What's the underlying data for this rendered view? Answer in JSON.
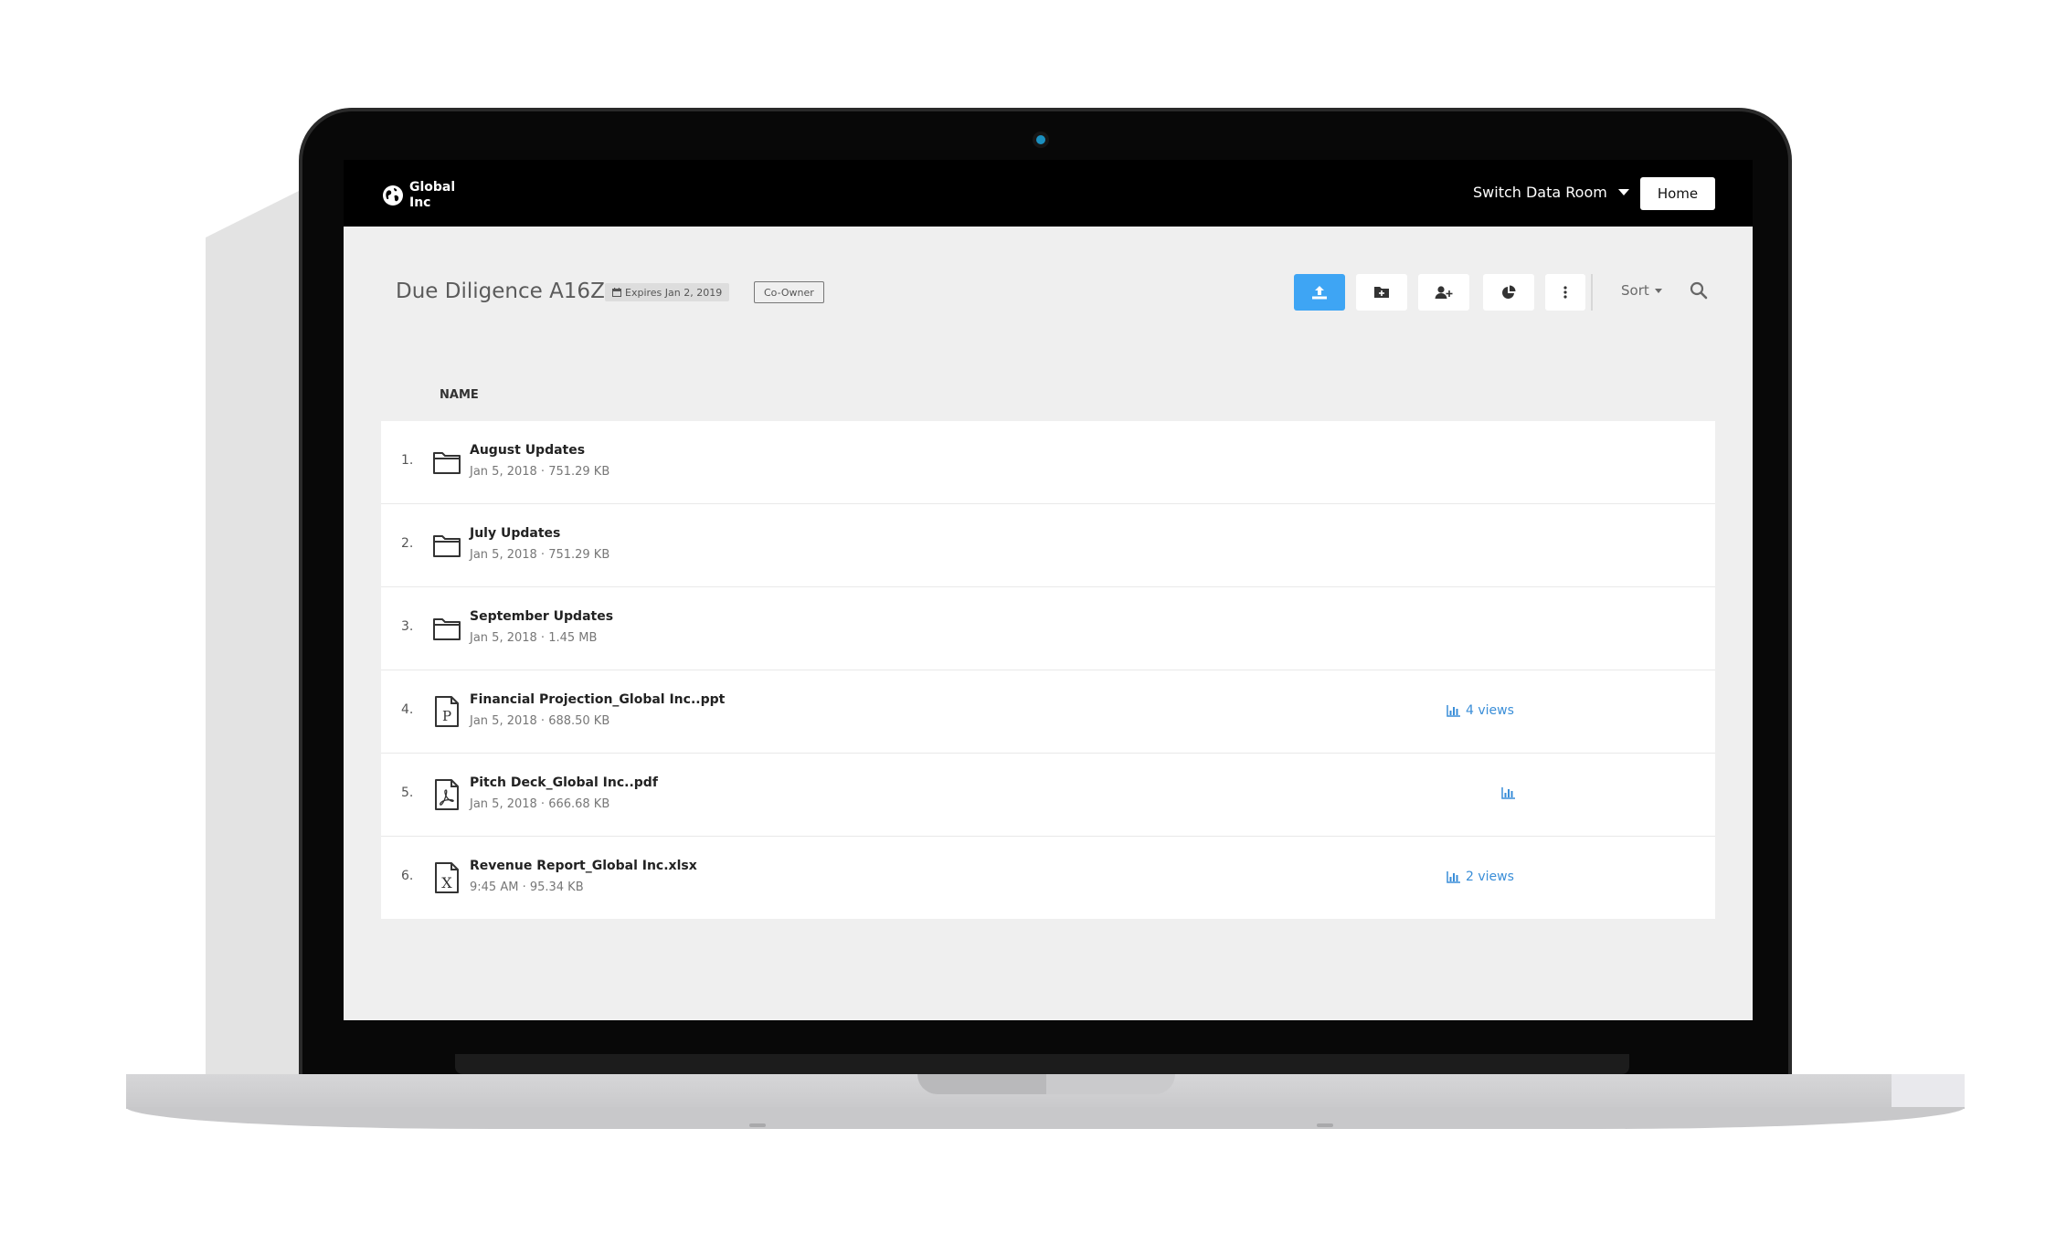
{
  "app": {
    "logo_icon": "globe-icon",
    "logo_text": "Global Inc",
    "switch_room_label": "Switch Data Room",
    "home_label": "Home"
  },
  "room": {
    "title": "Due Diligence A16Z",
    "expires_label": "Expires Jan 2, 2019",
    "role_label": "Co-Owner"
  },
  "toolbar": {
    "buttons": [
      {
        "icon": "upload-icon",
        "primary": true
      },
      {
        "icon": "new-folder-icon",
        "primary": false
      },
      {
        "icon": "add-user-icon",
        "primary": false
      },
      {
        "icon": "pie-chart-icon",
        "primary": false
      },
      {
        "icon": "more-vertical-icon",
        "primary": false
      }
    ],
    "sort_label": "Sort",
    "search_icon": "search-icon"
  },
  "list": {
    "column_name": "NAME",
    "files": [
      {
        "num": "1.",
        "type": "folder",
        "name": "August Updates",
        "meta": "Jan 5, 2018 · 751.29 KB",
        "views": ""
      },
      {
        "num": "2.",
        "type": "folder",
        "name": "July Updates",
        "meta": "Jan 5, 2018 · 751.29 KB",
        "views": ""
      },
      {
        "num": "3.",
        "type": "folder",
        "name": "September Updates",
        "meta": "Jan 5, 2018 · 1.45 MB",
        "views": ""
      },
      {
        "num": "4.",
        "type": "ppt",
        "name": "Financial Projection_Global Inc..ppt",
        "meta": "Jan 5, 2018 · 688.50 KB",
        "views": "4 views",
        "show_stats": true
      },
      {
        "num": "5.",
        "type": "pdf",
        "name": "Pitch Deck_Global Inc..pdf",
        "meta": "Jan 5, 2018 · 666.68 KB",
        "views": "",
        "show_stats": true
      },
      {
        "num": "6.",
        "type": "xlsx",
        "name": "Revenue Report_Global Inc.xlsx",
        "meta": "9:45 AM · 95.34 KB",
        "views": "2 views",
        "show_stats": true
      }
    ]
  },
  "colors": {
    "accent": "#3ea5f4",
    "link": "#3a8ed8",
    "topbar": "#000000",
    "screen_bg": "#efefef"
  }
}
